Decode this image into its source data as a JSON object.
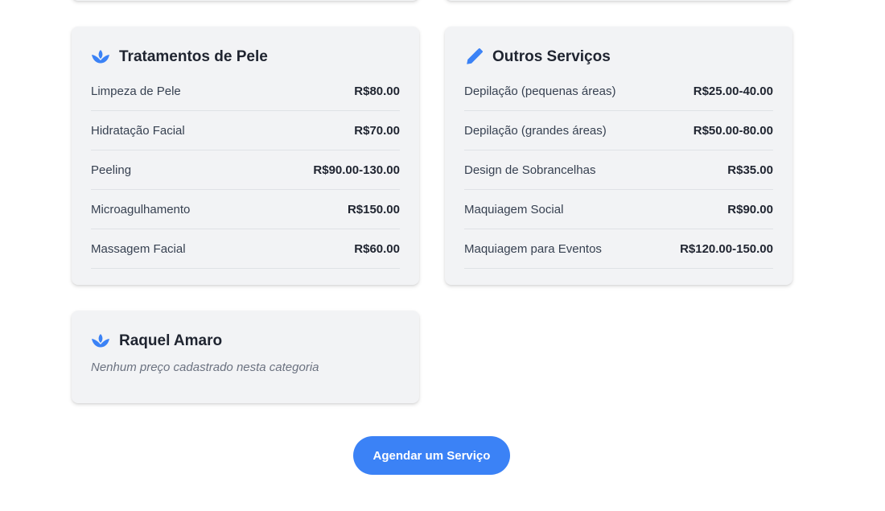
{
  "colors": {
    "accent": "#3b82f6",
    "card_bg": "#f2f3f5"
  },
  "cards": [
    {
      "title": "Tratamentos de Pele",
      "icon": "spa-lotus-icon",
      "items": [
        {
          "service": "Limpeza de Pele",
          "price": "R$80.00"
        },
        {
          "service": "Hidratação Facial",
          "price": "R$70.00"
        },
        {
          "service": "Peeling",
          "price": "R$90.00-130.00"
        },
        {
          "service": "Microagulhamento",
          "price": "R$150.00"
        },
        {
          "service": "Massagem Facial",
          "price": "R$60.00"
        }
      ]
    },
    {
      "title": "Outros Serviços",
      "icon": "pencil-icon",
      "items": [
        {
          "service": "Depilação (pequenas áreas)",
          "price": "R$25.00-40.00"
        },
        {
          "service": "Depilação (grandes áreas)",
          "price": "R$50.00-80.00"
        },
        {
          "service": "Design de Sobrancelhas",
          "price": "R$35.00"
        },
        {
          "service": "Maquiagem Social",
          "price": "R$90.00"
        },
        {
          "service": "Maquiagem para Eventos",
          "price": "R$120.00-150.00"
        }
      ]
    },
    {
      "title": "Raquel Amaro",
      "icon": "spa-lotus-icon",
      "empty_message": "Nenhum preço cadastrado nesta categoria"
    }
  ],
  "cta": {
    "label": "Agendar um Serviço"
  }
}
